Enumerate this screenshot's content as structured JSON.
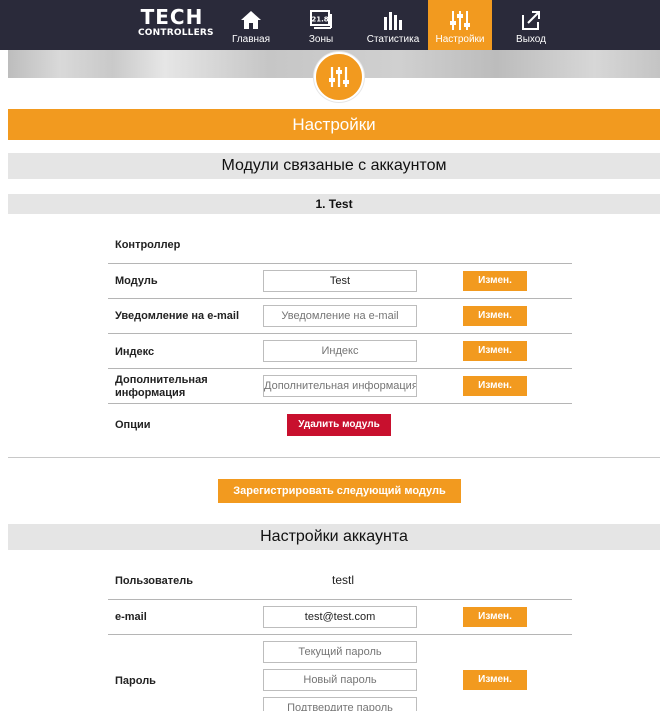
{
  "nav": {
    "logo_main": "TECH",
    "logo_sub": "CONTROLLERS",
    "items": [
      {
        "label": "Главная",
        "icon": "home-icon"
      },
      {
        "label": "Зоны",
        "icon": "zones-icon",
        "badge": "21.8"
      },
      {
        "label": "Статистика",
        "icon": "bar-chart-icon"
      },
      {
        "label": "Настройки",
        "icon": "sliders-icon",
        "active": true
      },
      {
        "label": "Выход",
        "icon": "logout-icon"
      }
    ]
  },
  "colors": {
    "accent": "#f29a1f",
    "nav_bg": "#2a2a3a",
    "danger": "#c8102e",
    "section_bg": "#e5e5e5"
  },
  "page_title": "Настройки",
  "modules_section": {
    "title": "Модули связаные с аккаунтом",
    "module_title": "1. Test",
    "controller_label": "Контроллер",
    "rows": [
      {
        "label": "Модуль",
        "value": "Test",
        "placeholder": "",
        "button": "Измен."
      },
      {
        "label": "Уведомление на e-mail",
        "value": "",
        "placeholder": "Уведомление на e-mail",
        "button": "Измен."
      },
      {
        "label": "Индекс",
        "value": "",
        "placeholder": "Индекс",
        "button": "Измен."
      },
      {
        "label": "Дополнительная информация",
        "value": "",
        "placeholder": "Дополнительная информация",
        "button": "Измен."
      }
    ],
    "options_label": "Опции",
    "delete_button": "Удалить модуль",
    "register_button": "Зарегистрировать следующий модуль"
  },
  "account_section": {
    "title": "Настройки аккаунта",
    "user_label": "Пользователь",
    "user_value": "testl",
    "email_label": "e-mail",
    "email_value": "test@test.com",
    "email_button": "Измен.",
    "password_label": "Пароль",
    "password_current_placeholder": "Текущий пароль",
    "password_new_placeholder": "Новый пароль",
    "password_confirm_placeholder": "Подтвердите пароль",
    "password_button": "Измен."
  }
}
